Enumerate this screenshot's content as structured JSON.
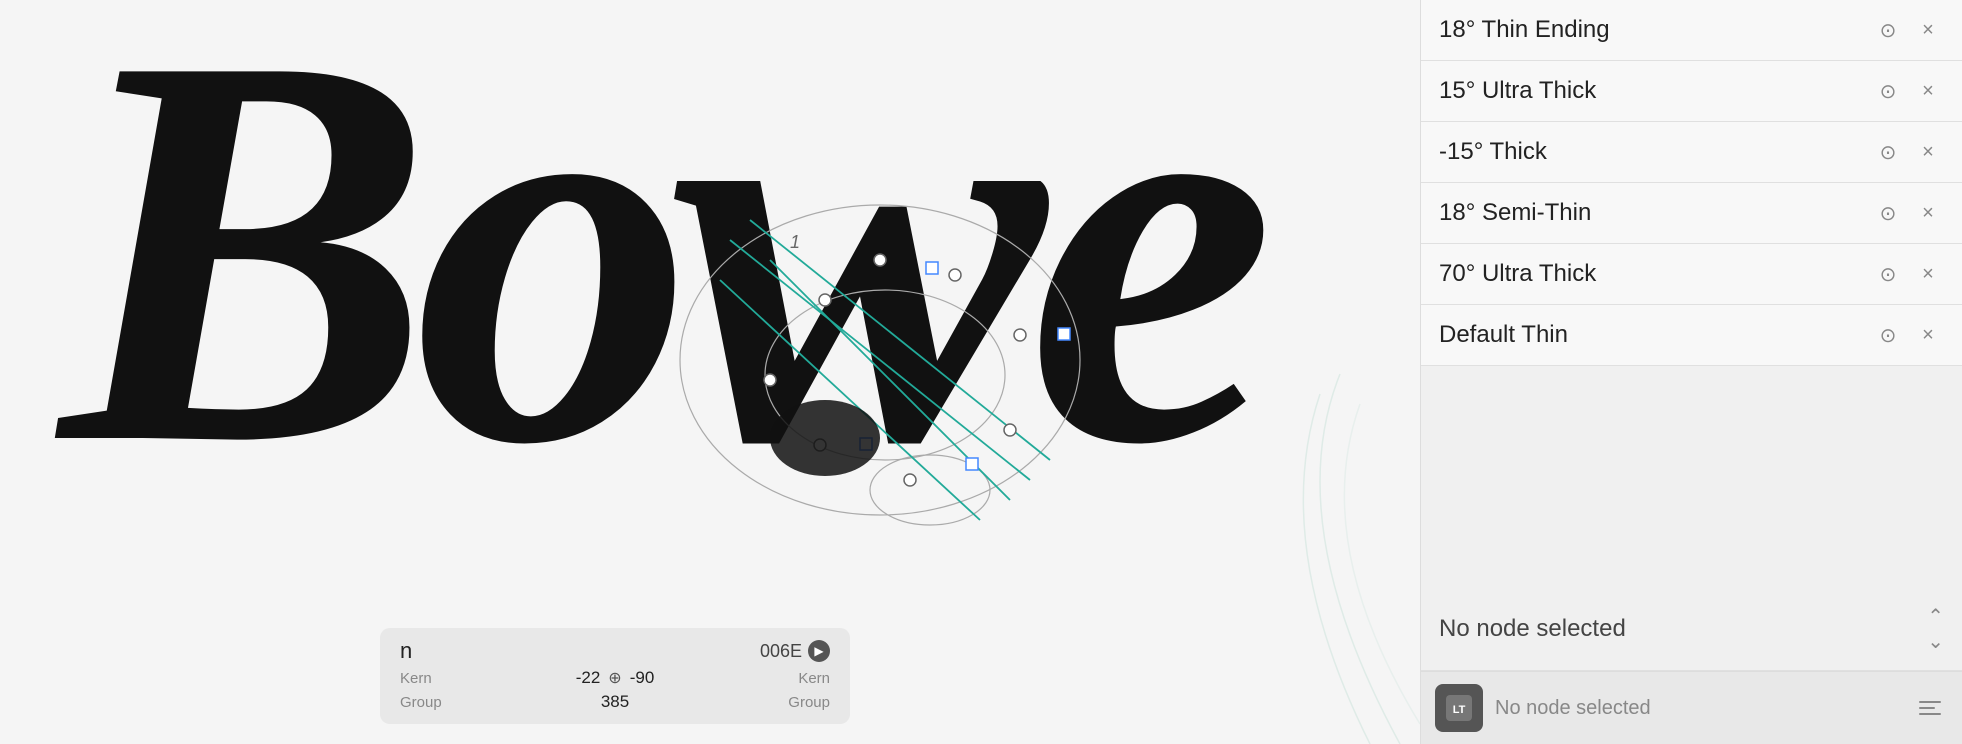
{
  "canvas": {
    "script_text": "Bowe",
    "bg_color": "#f5f5f5"
  },
  "glyph_info": {
    "name": "n",
    "unicode": "006E",
    "kern_left_label": "Kern",
    "kern_right_label": "Kern",
    "kern_left_value": "-22",
    "kern_right_value": "-90",
    "group_left_label": "Group",
    "group_right_label": "Group",
    "group_value": "385"
  },
  "right_panel": {
    "guides": [
      {
        "id": 1,
        "label": "18° Thin Ending"
      },
      {
        "id": 2,
        "label": "15° Ultra Thick"
      },
      {
        "id": 3,
        "label": "-15° Thick"
      },
      {
        "id": 4,
        "label": "18° Semi-Thin"
      },
      {
        "id": 5,
        "label": "70° Ultra Thick"
      },
      {
        "id": 6,
        "label": "Default Thin"
      }
    ],
    "no_node_selected_label": "No node selected",
    "node_info_placeholder": "No node selected",
    "more_icon": "⊙",
    "close_icon": "×",
    "chevron_label": "⌃⌄"
  }
}
